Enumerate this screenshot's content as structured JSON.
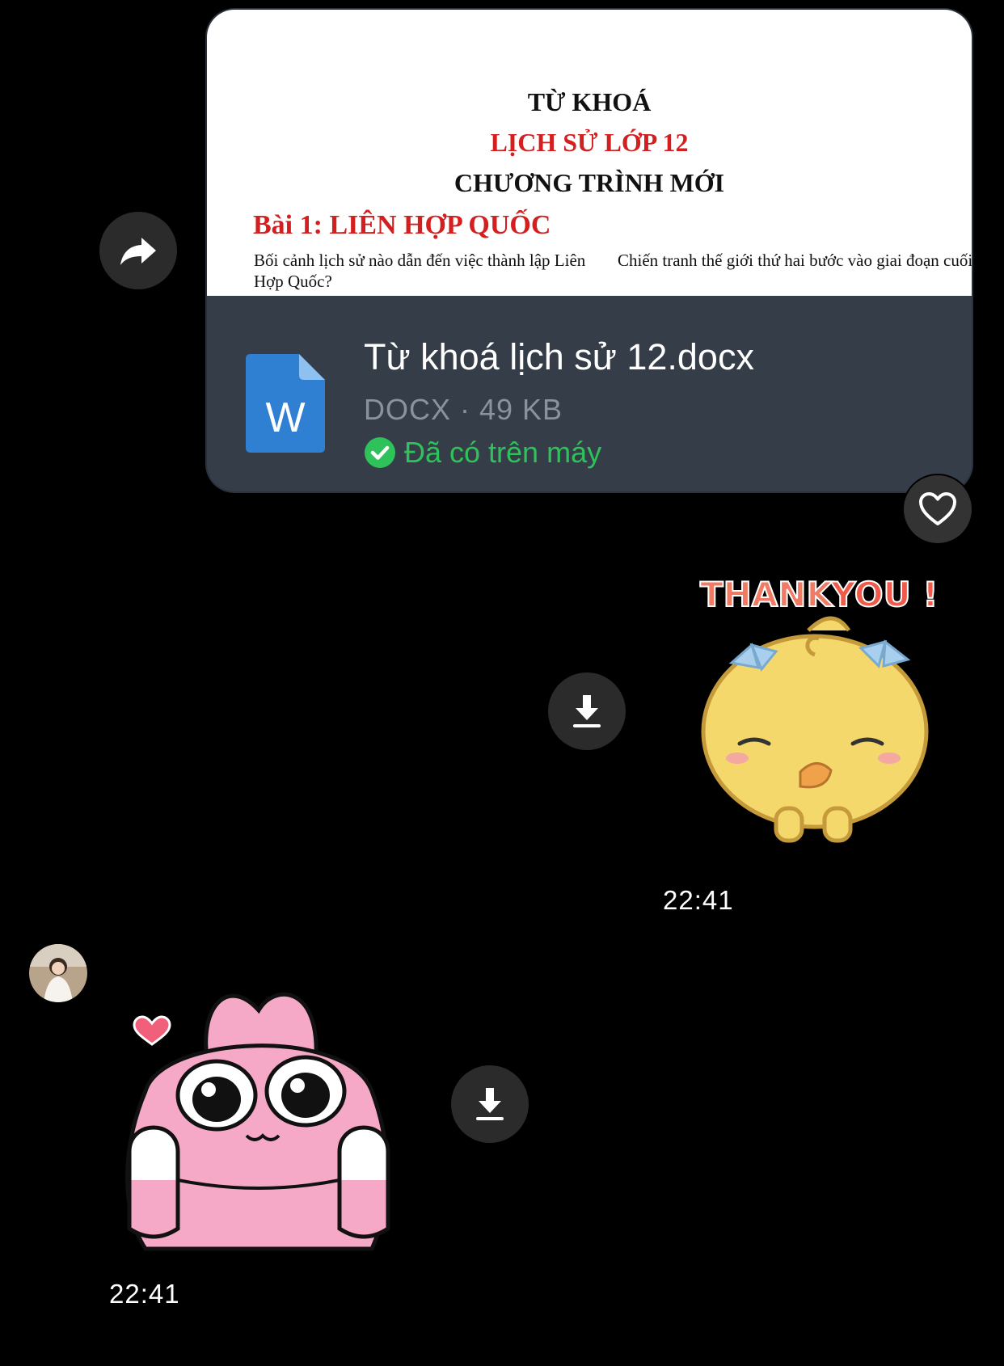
{
  "file_message": {
    "preview": {
      "title_line1": "TỪ KHOÁ",
      "title_line2": "LỊCH SỬ LỚP 12",
      "title_line3": "CHƯƠNG TRÌNH MỚI",
      "lesson": "Bài 1: LIÊN HỢP QUỐC",
      "question_left": "Bối cảnh lịch sử nào dẫn đến việc thành lập Liên Hợp Quốc?",
      "question_right": "Chiến tranh thế giới thứ hai bước vào giai đoạn cuối"
    },
    "file_name": "Từ khoá lịch sử 12.docx",
    "file_meta": "DOCX · 49 KB",
    "status": "Đã có trên máy",
    "icon": "word-docx-icon",
    "icon_letter": "W"
  },
  "sent_sticker": {
    "caption_part1": "THANK",
    "caption_part2": "YOU !",
    "time": "22:41"
  },
  "received_sticker": {
    "time": "22:41"
  },
  "colors": {
    "background": "#000000",
    "file_card": "#353d49",
    "status_green": "#30c25a",
    "preview_red": "#d31f1f",
    "button_bg": "#2b2b2b"
  }
}
